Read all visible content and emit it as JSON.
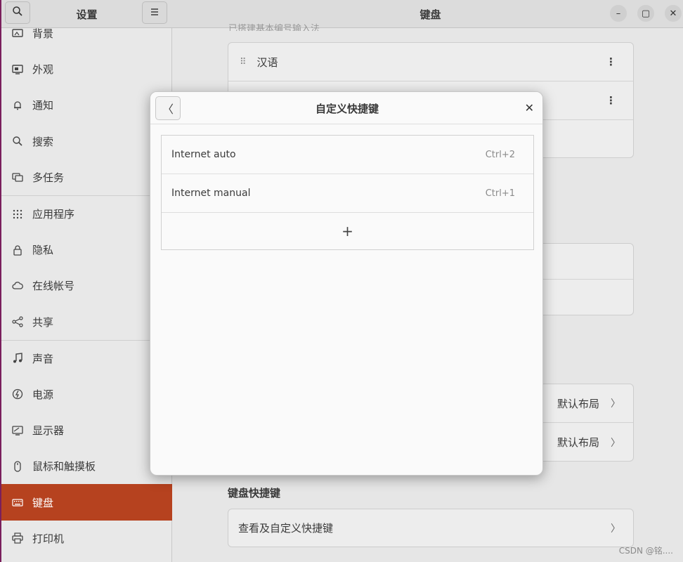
{
  "sidebar": {
    "title": "设置",
    "items": [
      {
        "label": "背景",
        "icon": "background-icon"
      },
      {
        "label": "外观",
        "icon": "appearance-icon"
      },
      {
        "label": "通知",
        "icon": "bell-icon"
      },
      {
        "label": "搜索",
        "icon": "search-icon"
      },
      {
        "label": "多任务",
        "icon": "multitasking-icon"
      },
      {
        "label": "应用程序",
        "icon": "apps-grid-icon"
      },
      {
        "label": "隐私",
        "icon": "lock-icon"
      },
      {
        "label": "在线帐号",
        "icon": "cloud-icon"
      },
      {
        "label": "共享",
        "icon": "share-icon"
      },
      {
        "label": "声音",
        "icon": "music-note-icon"
      },
      {
        "label": "电源",
        "icon": "power-icon"
      },
      {
        "label": "显示器",
        "icon": "display-icon"
      },
      {
        "label": "鼠标和触摸板",
        "icon": "mouse-icon"
      },
      {
        "label": "键盘",
        "icon": "keyboard-icon"
      },
      {
        "label": "打印机",
        "icon": "printer-icon"
      }
    ]
  },
  "main": {
    "title": "键盘",
    "input_sources_hint": "已搭建基本编号输入法",
    "input_sources": [
      {
        "label": "汉语"
      }
    ],
    "layout_rows": [
      {
        "value": "默认布局"
      },
      {
        "value": "默认布局"
      }
    ],
    "shortcuts_section": "键盘快捷键",
    "shortcuts_row": "查看及自定义快捷键"
  },
  "dialog": {
    "title": "自定义快捷键",
    "shortcuts": [
      {
        "name": "Internet auto",
        "keys": "Ctrl+2"
      },
      {
        "name": "Internet manual",
        "keys": "Ctrl+1"
      }
    ],
    "add_label": "+"
  },
  "watermark": "CSDN @铭...."
}
